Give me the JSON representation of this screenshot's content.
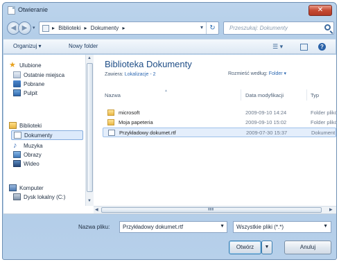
{
  "window": {
    "title": "Otwieranie",
    "close_label": "✕"
  },
  "address": {
    "breadcrumbs": [
      "Biblioteki",
      "Dokumenty"
    ],
    "search_placeholder": "Przeszukaj: Dokumenty"
  },
  "toolbar": {
    "organize_label": "Organizuj ▾",
    "new_folder_label": "Nowy folder",
    "view_label": "☰ ▾"
  },
  "sidebar": {
    "favorites": {
      "label": "Ulubione",
      "items": [
        "Ostatnie miejsca",
        "Pobrane",
        "Pulpit"
      ]
    },
    "libraries": {
      "label": "Biblioteki",
      "items": [
        "Dokumenty",
        "Muzyka",
        "Obrazy",
        "Wideo"
      ]
    },
    "computer": {
      "label": "Komputer",
      "items": [
        "Dysk lokalny (C:)"
      ]
    }
  },
  "main": {
    "library_title": "Biblioteka Dokumenty",
    "includes_label": "Zawiera:",
    "includes_link": "Lokalizacje - 2",
    "arrange_label": "Rozmieść według:",
    "arrange_value": "Folder ▾",
    "columns": {
      "name": "Nazwa",
      "date": "Data modyfikacji",
      "type": "Typ"
    },
    "rows": [
      {
        "name": "microsoft",
        "date": "2009-09-10 14:24",
        "type": "Folder plików"
      },
      {
        "name": "Moja papeteria",
        "date": "2009-09-10 15:02",
        "type": "Folder plików"
      },
      {
        "name": "Przykładowy dokumet.rtf",
        "date": "2009-07-30 15:37",
        "type": "Dokument"
      }
    ]
  },
  "bottom": {
    "filename_label": "Nazwa pliku:",
    "filename_value": "Przykładowy dokumet.rtf",
    "filter_value": "Wszystkie pliki (*.*)",
    "open_label": "Otwórz",
    "cancel_label": "Anuluj"
  }
}
